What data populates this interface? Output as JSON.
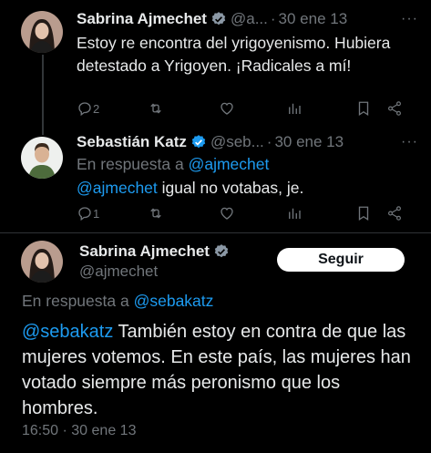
{
  "tweets": [
    {
      "name": "Sabrina Ajmechet",
      "handle": "@a...",
      "date": "30 ene 13",
      "text": "Estoy re encontra del yrigoyenismo. Hubiera detestado a Yrigoyen. ¡Radicales a mí!",
      "replies": "2",
      "more": "···"
    },
    {
      "name": "Sebastián Katz",
      "handle": "@seb...",
      "date": "30 ene 13",
      "reply_prefix": "En respuesta a",
      "reply_to": "@ajmechet",
      "mention": "@ajmechet",
      "text": " igual no votabas, je.",
      "replies": "1",
      "more": "···"
    }
  ],
  "main": {
    "name": "Sabrina Ajmechet",
    "handle": "@ajmechet",
    "follow_label": "Seguir",
    "reply_prefix": "En respuesta a",
    "reply_to": "@sebakatz",
    "mention": "@sebakatz",
    "text": " También estoy en contra de que las mujeres votemos. En este país, las mujeres han votado siempre más peronismo que los hombres.",
    "time": "16:50",
    "date": "30 ene 13"
  },
  "colors": {
    "link": "#1d9bf0",
    "verified": "#1d9bf0",
    "muted": "#71767b",
    "background": "#000000"
  }
}
